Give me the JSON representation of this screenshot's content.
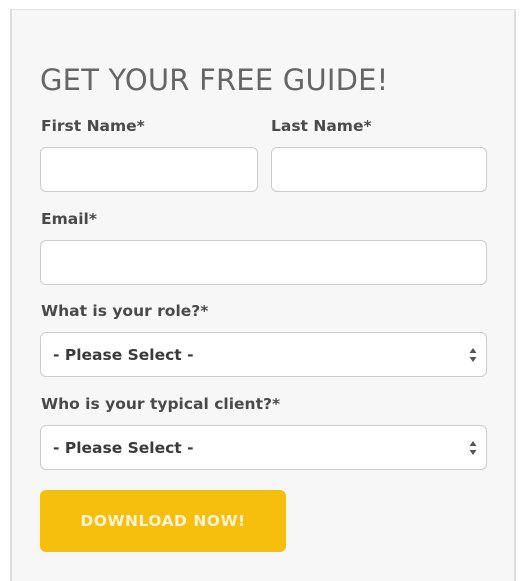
{
  "form": {
    "title": "GET YOUR FREE GUIDE!",
    "first_name": {
      "label": "First Name*",
      "value": ""
    },
    "last_name": {
      "label": "Last Name*",
      "value": ""
    },
    "email": {
      "label": "Email*",
      "value": ""
    },
    "role": {
      "label": "What is your role?*",
      "selected": "- Please Select -"
    },
    "client": {
      "label": "Who is your typical client?*",
      "selected": "- Please Select -"
    },
    "submit_label": "DOWNLOAD NOW!"
  },
  "colors": {
    "button": "#f6be0d",
    "button_text": "#fdf3d2",
    "card_background": "#f7f7f7",
    "field_border": "#cccccc"
  },
  "icons": {
    "select_arrows": "up-down-caret-icon"
  }
}
